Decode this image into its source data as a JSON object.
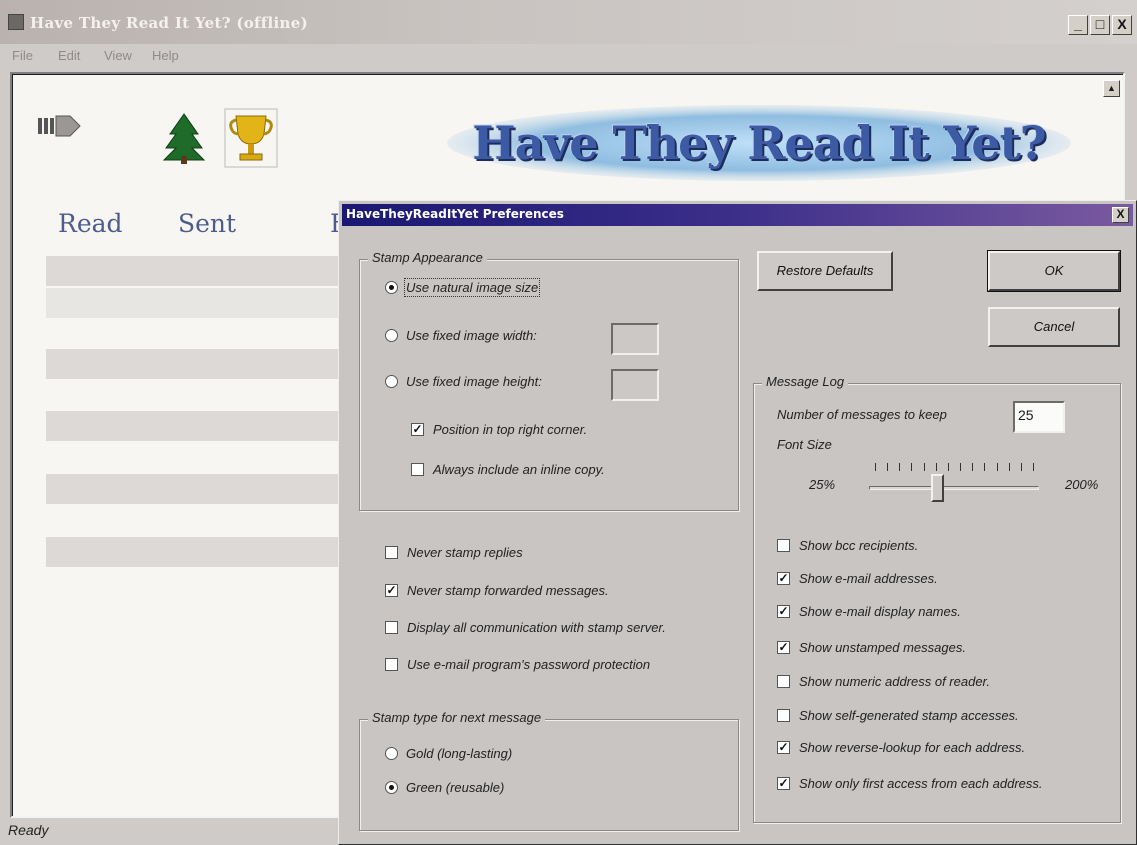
{
  "window": {
    "title": "Have They Read It Yet? (offline)",
    "controls": {
      "minimize": "_",
      "maximize": "□",
      "close": "X"
    },
    "menu": [
      "File",
      "Edit",
      "View",
      "Help"
    ]
  },
  "main": {
    "banner_text": "Have They Read It Yet?",
    "columns": {
      "read": "Read",
      "sent": "Sent",
      "third": "F"
    },
    "status": "Ready"
  },
  "dialog": {
    "title": "HaveTheyReadItYet Preferences",
    "close": "X",
    "restore_defaults": "Restore Defaults",
    "ok": "OK",
    "cancel": "Cancel",
    "stamp_appearance": {
      "label": "Stamp Appearance",
      "natural": "Use natural image size",
      "fixed_width": "Use fixed image width:",
      "fixed_height": "Use fixed image height:",
      "position_top_right": "Position in top right corner.",
      "inline_copy": "Always include an inline copy."
    },
    "options": {
      "never_replies": "Never stamp replies",
      "never_forwarded": "Never stamp forwarded messages.",
      "display_all": "Display all communication with stamp server.",
      "password_protection": "Use e-mail program's password protection"
    },
    "stamp_type": {
      "label": "Stamp type for next message",
      "gold": "Gold (long-lasting)",
      "green": "Green (reusable)"
    },
    "message_log": {
      "label": "Message Log",
      "keep_label": "Number of messages to keep",
      "keep_value": "25",
      "font_size_label": "Font Size",
      "min": "25%",
      "max": "200%",
      "font_size_level": 0.4,
      "show_bcc": "Show bcc recipients.",
      "show_email": "Show e-mail addresses.",
      "show_display_names": "Show e-mail display names.",
      "show_unstamped": "Show unstamped messages.",
      "show_numeric": "Show numeric address of reader.",
      "show_self_generated": "Show self-generated stamp accesses.",
      "show_reverse_lookup": "Show reverse-lookup for each address.",
      "show_first_access": "Show only first access from each address."
    }
  }
}
